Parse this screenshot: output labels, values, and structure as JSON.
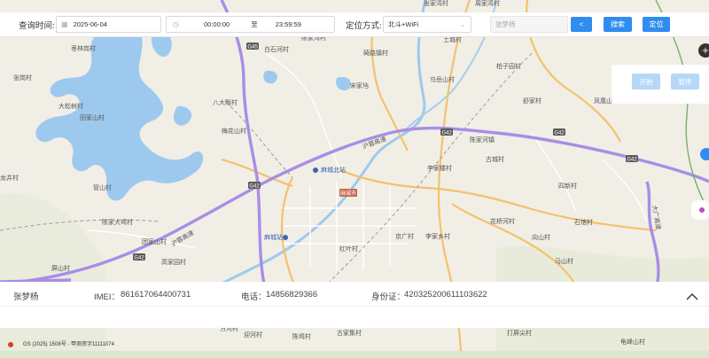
{
  "toolbar": {
    "query_time_label": "查询时间:",
    "date": "2025-06-04",
    "time_start": "00:00:00",
    "time_to": "至",
    "time_end": "23:59:59",
    "positioning_label": "定位方式:",
    "positioning_value": "北斗+WiFi",
    "person_placeholder": "张梦杨",
    "search_button": "搜索",
    "locate_button": "定位"
  },
  "playback": {
    "start_button": "开始",
    "pause_button": "暂停"
  },
  "info": {
    "name": "张梦杨",
    "imei_label": "IMEI：",
    "imei": "861617064400731",
    "phone_label": "电话：",
    "phone": "14856829366",
    "id_label": "身份证：",
    "id_number": "420325200611103622"
  },
  "map": {
    "labels": {
      "zhangjiawan": "张家湾村",
      "zhoujiawan": "周家湾村",
      "chenjiawan": "陈家湾村",
      "tucheng": "土城村",
      "baihehe": "白石河村",
      "qiaotouzhen": "碕路镇村",
      "baizi": "柏子园村",
      "shucun": "舒家村",
      "zaolin": "枣林岗村",
      "zhanggang": "张岗村",
      "dasongshu": "大松树村",
      "baguashan": "八大畈村",
      "songjiadong": "宋家垱",
      "wujiangshan": "乌岳山村",
      "shanren": "陈家河镇",
      "fenghuang": "凤凰山村",
      "tianjiashan": "田家山村",
      "meihua": "梅花山村",
      "macheng_north": "麻城北站",
      "lijia": "李家楼村",
      "gucheng": "古城村",
      "sixin": "四新村",
      "longjing": "龙井村",
      "guanshan": "管山村",
      "macheng_city": "麻城市",
      "chenjiadaqiao": "陈家大塆村",
      "macheng_station": "麻城站",
      "jingguang": "京广村",
      "lijiaxiang": "李家乡村",
      "huaqiao": "花桥河村",
      "shiguan": "石馆村",
      "xiangshan": "向山村",
      "honghe": "红叶村",
      "tuanjiashan": "团家山村",
      "mashan": "马山村",
      "pingshan": "屏山村",
      "gaojiayuan": "高家园村",
      "fanghe": "方河村",
      "yingshan": "迎河村",
      "chenqiao": "陈塆村",
      "gujia": "古家集村",
      "guijie": "龟峰山村",
      "dapinghu": "打屏尖村",
      "road_g45": "G45",
      "road_g42_a": "G42",
      "road_g42_b": "G42",
      "road_g42_c": "G42",
      "road_g42_d": "G42",
      "road_g42_e": "G42",
      "hu_rong_a": "沪蓉高速",
      "hu_rong_b": "沪蓉高速",
      "da_guang": "大广高速"
    }
  },
  "copyright": "GS (2025) 1508号 - 甲测资字11111074",
  "colors": {
    "primary": "#2f8cf0",
    "primary_light": "#b7d7f8",
    "water": "#9ec9ee",
    "highway": "#a98de6",
    "main_road": "#f3c26b"
  }
}
